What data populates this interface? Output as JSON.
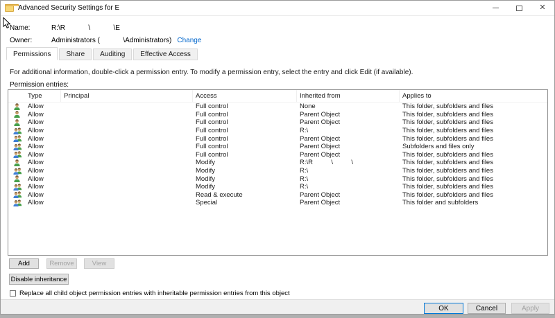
{
  "window": {
    "title": "Advanced Security Settings for E"
  },
  "fields": {
    "name_label": "Name:",
    "name_value": "R:\\R            \\            \\E",
    "owner_label": "Owner:",
    "owner_value": "Administrators (            \\Administrators)",
    "change_link": "Change"
  },
  "tabs": {
    "items": [
      {
        "label": "Permissions",
        "active": true
      },
      {
        "label": "Share",
        "active": false
      },
      {
        "label": "Auditing",
        "active": false
      },
      {
        "label": "Effective Access",
        "active": false
      }
    ]
  },
  "main": {
    "info_text": "For additional information, double-click a permission entry. To modify a permission entry, select the entry and click Edit (if available).",
    "entries_label": "Permission entries:"
  },
  "table": {
    "headers": [
      "Type",
      "Principal",
      "Access",
      "Inherited from",
      "Applies to"
    ],
    "rows": [
      {
        "icon": "user",
        "type": "Allow",
        "principal": "",
        "access": "Full control",
        "inherited_from": "None",
        "applies_to": "This folder, subfolders and files"
      },
      {
        "icon": "user",
        "type": "Allow",
        "principal": "",
        "access": "Full control",
        "inherited_from": "Parent Object",
        "applies_to": "This folder, subfolders and files"
      },
      {
        "icon": "user",
        "type": "Allow",
        "principal": "",
        "access": "Full control",
        "inherited_from": "Parent Object",
        "applies_to": "This folder, subfolders and files"
      },
      {
        "icon": "group",
        "type": "Allow",
        "principal": "",
        "access": "Full control",
        "inherited_from": "R:\\",
        "applies_to": "This folder, subfolders and files"
      },
      {
        "icon": "group",
        "type": "Allow",
        "principal": "",
        "access": "Full control",
        "inherited_from": "Parent Object",
        "applies_to": "This folder, subfolders and files"
      },
      {
        "icon": "group",
        "type": "Allow",
        "principal": "",
        "access": "Full control",
        "inherited_from": "Parent Object",
        "applies_to": "Subfolders and files only"
      },
      {
        "icon": "group",
        "type": "Allow",
        "principal": "",
        "access": "Full control",
        "inherited_from": "Parent Object",
        "applies_to": "This folder, subfolders and files"
      },
      {
        "icon": "user",
        "type": "Allow",
        "principal": "",
        "access": "Modify",
        "inherited_from": "R:\\R          \\          \\",
        "applies_to": "This folder, subfolders and files"
      },
      {
        "icon": "group",
        "type": "Allow",
        "principal": "",
        "access": "Modify",
        "inherited_from": "R:\\",
        "applies_to": "This folder, subfolders and files"
      },
      {
        "icon": "user",
        "type": "Allow",
        "principal": "",
        "access": "Modify",
        "inherited_from": "R:\\",
        "applies_to": "This folder, subfolders and files"
      },
      {
        "icon": "group",
        "type": "Allow",
        "principal": "",
        "access": "Modify",
        "inherited_from": "R:\\",
        "applies_to": "This folder, subfolders and files"
      },
      {
        "icon": "group",
        "type": "Allow",
        "principal": "",
        "access": "Read & execute",
        "inherited_from": "Parent Object",
        "applies_to": "This folder, subfolders and files"
      },
      {
        "icon": "group",
        "type": "Allow",
        "principal": "",
        "access": "Special",
        "inherited_from": "Parent Object",
        "applies_to": "This folder and subfolders"
      }
    ]
  },
  "actions": {
    "add": "Add",
    "remove": "Remove",
    "view": "View",
    "disable_inheritance": "Disable inheritance"
  },
  "checkbox": {
    "label": "Replace all child object permission entries with inheritable permission entries from this object",
    "checked": false
  },
  "footer": {
    "ok": "OK",
    "cancel": "Cancel",
    "apply": "Apply"
  },
  "colors": {
    "link": "#0066cc",
    "ok_focus_border": "#0078d7",
    "disabled_text": "#a3a3a3",
    "folder_icon": "#f8d776"
  }
}
